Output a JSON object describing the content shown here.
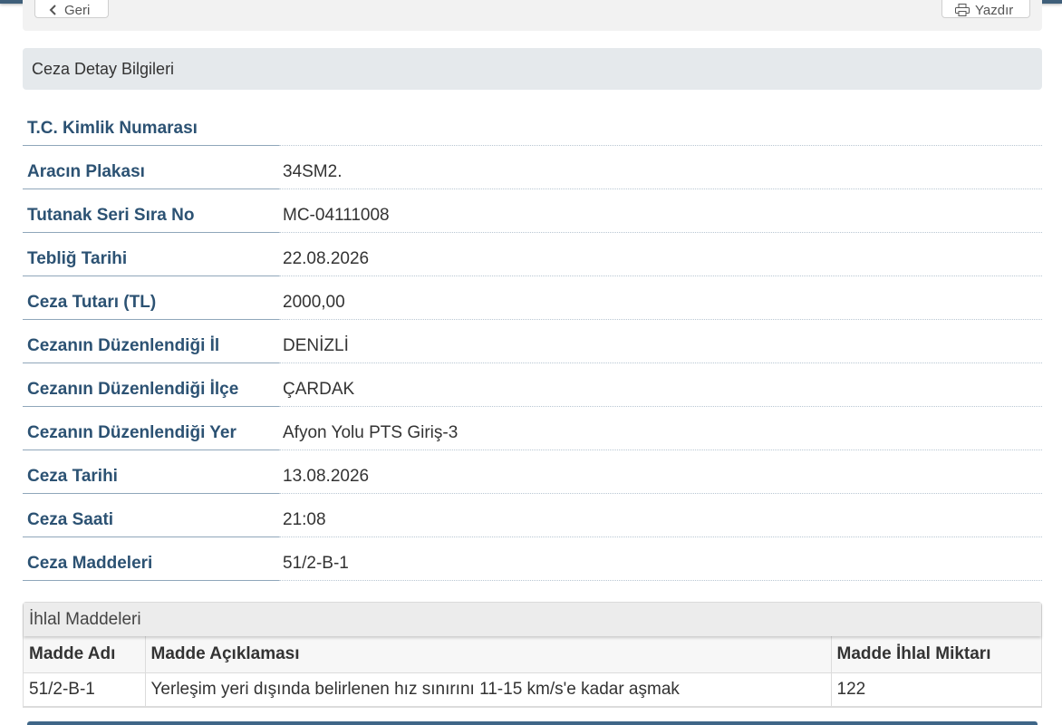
{
  "toolbar": {
    "back_label": "Geri",
    "print_label": "Yazdır"
  },
  "panel": {
    "title": "Ceza Detay Bilgileri"
  },
  "details": [
    {
      "label": "T.C. Kimlik Numarası",
      "value": ""
    },
    {
      "label": "Aracın Plakası",
      "value": "34SM2."
    },
    {
      "label": "Tutanak Seri Sıra No",
      "value": "MC-04111008"
    },
    {
      "label": "Tebliğ Tarihi",
      "value": "22.08.2026"
    },
    {
      "label": "Ceza Tutarı (TL)",
      "value": "2000,00"
    },
    {
      "label": "Cezanın Düzenlendiği İl",
      "value": "DENİZLİ"
    },
    {
      "label": "Cezanın Düzenlendiği İlçe",
      "value": "ÇARDAK"
    },
    {
      "label": "Cezanın Düzenlendiği Yer",
      "value": "Afyon Yolu PTS Giriş-3"
    },
    {
      "label": "Ceza Tarihi",
      "value": "13.08.2026"
    },
    {
      "label": "Ceza Saati",
      "value": "21:08"
    },
    {
      "label": "Ceza Maddeleri",
      "value": "51/2-B-1"
    }
  ],
  "ihlal": {
    "title": "İhlal Maddeleri",
    "columns": [
      "Madde Adı",
      "Madde Açıklaması",
      "Madde İhlal Miktarı"
    ],
    "rows": [
      [
        "51/2-B-1",
        "Yerleşim yeri dışında belirlenen hız sınırını 11-15 km/s'e kadar aşmak",
        "122"
      ]
    ]
  }
}
